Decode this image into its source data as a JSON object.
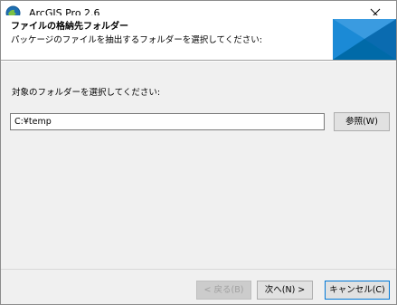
{
  "window": {
    "title": "ArcGIS Pro 2.6",
    "close_icon": "close-icon"
  },
  "header": {
    "title": "ファイルの格納先フォルダー",
    "subtitle": "パッケージのファイルを抽出するフォルダーを選択してください:"
  },
  "content": {
    "prompt": "対象のフォルダーを選択してください:",
    "path_value": "C:¥temp",
    "browse_label": "参照(W)"
  },
  "footer": {
    "back_label": "< 戻る(B)",
    "next_label": "次へ(N) >",
    "cancel_label": "キャンセル(C)"
  },
  "colors": {
    "brand_blue": "#0079c1",
    "brand_light": "#5aa7e0",
    "focus_border": "#0078d7"
  }
}
